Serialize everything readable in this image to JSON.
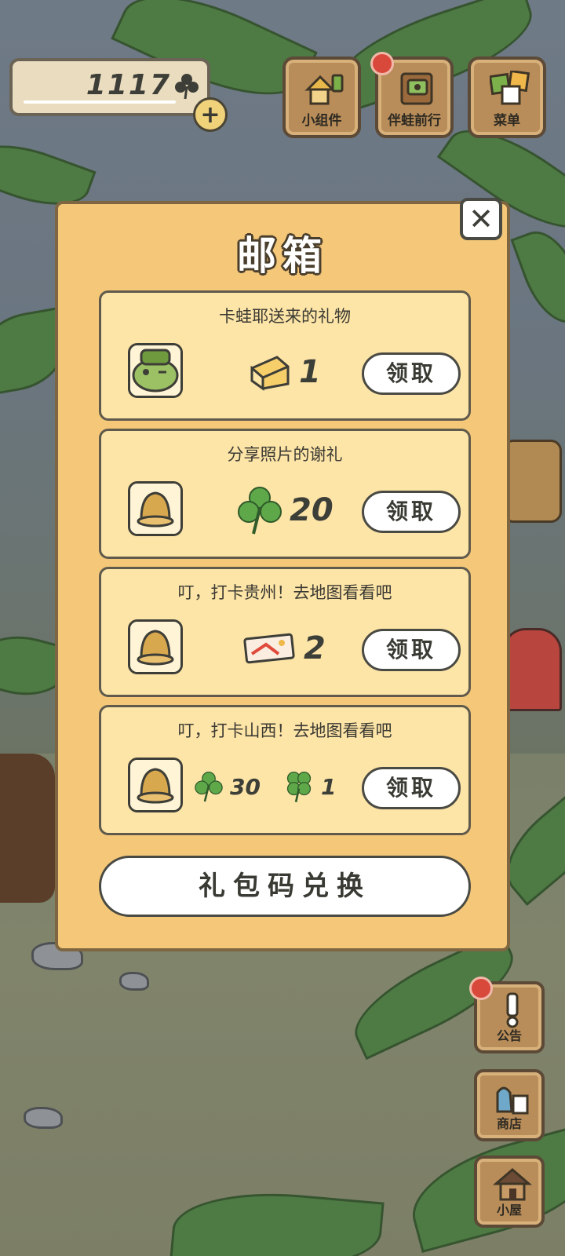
{
  "hud": {
    "clover_count": "1117",
    "plus_label": "+",
    "buttons": [
      {
        "label": "小组件",
        "icon": "widget-icon",
        "badge": false
      },
      {
        "label": "伴蛙前行",
        "icon": "travel-book-icon",
        "badge": true
      },
      {
        "label": "菜单",
        "icon": "menu-icon",
        "badge": false
      }
    ]
  },
  "mailbox": {
    "title": "邮箱",
    "close_label": "✕",
    "claim_label": "领取",
    "redeem_label": "礼包码兑换",
    "mails": [
      {
        "title": "卡蛙耶送来的礼物",
        "sender_icon": "frog-friend-icon",
        "rewards": [
          {
            "icon": "cheese-icon",
            "qty": "1"
          }
        ]
      },
      {
        "title": "分享照片的谢礼",
        "sender_icon": "bell-icon",
        "rewards": [
          {
            "icon": "clover-icon",
            "qty": "20"
          }
        ]
      },
      {
        "title": "叮，打卡贵州！去地图看看吧",
        "sender_icon": "bell-icon",
        "rewards": [
          {
            "icon": "ticket-icon",
            "qty": "2"
          }
        ]
      },
      {
        "title": "叮，打卡山西！去地图看看吧",
        "sender_icon": "bell-icon",
        "rewards": [
          {
            "icon": "clover-icon",
            "qty": "30"
          },
          {
            "icon": "four-leaf-clover-icon",
            "qty": "1"
          }
        ]
      }
    ]
  },
  "side": {
    "buttons": [
      {
        "label": "公告",
        "icon": "announcement-icon",
        "badge": true
      },
      {
        "label": "商店",
        "icon": "shop-icon",
        "badge": false
      },
      {
        "label": "小屋",
        "icon": "house-icon",
        "badge": false
      }
    ]
  },
  "colors": {
    "panel": "#f5c879",
    "card": "#fde4a7",
    "badge": "#d8493c",
    "wood": "#b88d5a"
  }
}
